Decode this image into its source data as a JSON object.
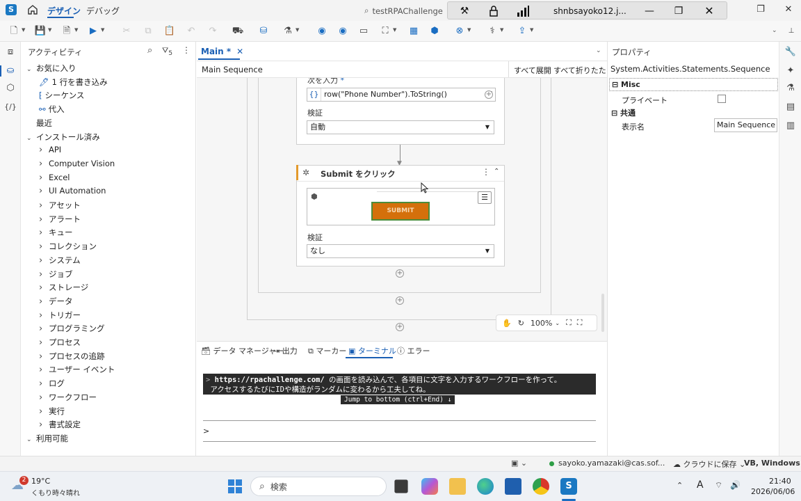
{
  "titlebar": {
    "app_logo": "S",
    "tab_design": "デザイン",
    "tab_debug": "デバッグ",
    "project_search": "testRPAChallenge",
    "rdp_user": "shnbsayoko12.j..."
  },
  "activities": {
    "title": "アクティビティ",
    "filter_count": "5",
    "items": [
      {
        "label": "お気に入り",
        "level": 0,
        "chev": "v"
      },
      {
        "label": "1 行を書き込み",
        "level": 1,
        "icon": "write-line"
      },
      {
        "label": "シーケンス",
        "level": 1,
        "icon": "sequence"
      },
      {
        "label": "代入",
        "level": 1,
        "icon": "assign"
      },
      {
        "label": "最近",
        "level": 0,
        "chev": ""
      },
      {
        "label": "インストール済み",
        "level": 0,
        "chev": "v"
      },
      {
        "label": "API",
        "level": 1,
        "chev": ">"
      },
      {
        "label": "Computer Vision",
        "level": 1,
        "chev": ">"
      },
      {
        "label": "Excel",
        "level": 1,
        "chev": ">"
      },
      {
        "label": "UI Automation",
        "level": 1,
        "chev": ">"
      },
      {
        "label": "アセット",
        "level": 1,
        "chev": ">"
      },
      {
        "label": "アラート",
        "level": 1,
        "chev": ">"
      },
      {
        "label": "キュー",
        "level": 1,
        "chev": ">"
      },
      {
        "label": "コレクション",
        "level": 1,
        "chev": ">"
      },
      {
        "label": "システム",
        "level": 1,
        "chev": ">"
      },
      {
        "label": "ジョブ",
        "level": 1,
        "chev": ">"
      },
      {
        "label": "ストレージ",
        "level": 1,
        "chev": ">"
      },
      {
        "label": "データ",
        "level": 1,
        "chev": ">"
      },
      {
        "label": "トリガー",
        "level": 1,
        "chev": ">"
      },
      {
        "label": "プログラミング",
        "level": 1,
        "chev": ">"
      },
      {
        "label": "プロセス",
        "level": 1,
        "chev": ">"
      },
      {
        "label": "プロセスの追跡",
        "level": 1,
        "chev": ">"
      },
      {
        "label": "ユーザー イベント",
        "level": 1,
        "chev": ">"
      },
      {
        "label": "ログ",
        "level": 1,
        "chev": ">"
      },
      {
        "label": "ワークフロー",
        "level": 1,
        "chev": ">"
      },
      {
        "label": "実行",
        "level": 1,
        "chev": ">"
      },
      {
        "label": "書式設定",
        "level": 1,
        "chev": ">"
      },
      {
        "label": "利用可能",
        "level": 0,
        "chev": "v"
      }
    ]
  },
  "designer": {
    "tab_label": "Main *",
    "breadcrumb": "Main Sequence",
    "expand_all": "すべて展開",
    "collapse_all": "すべて折りたたむ",
    "type_into": {
      "text_label": "次を入力",
      "required_mark": "*",
      "text_value": "row(\"Phone Number\").ToString()",
      "verify_label": "検証",
      "verify_value": "自動"
    },
    "click_activity": {
      "title": "Submit をクリック",
      "button_text": "SUBMIT",
      "verify_label": "検証",
      "verify_value": "なし"
    },
    "zoom": "100%"
  },
  "bottom_panel": {
    "tabs": [
      "データ マネージャー",
      "出力",
      "マーカー",
      "ターミナル",
      "エラー"
    ],
    "active_tab": "ターミナル",
    "terminal_line1_url": "https://rpachallenge.com/",
    "terminal_line1_rest": " の画面を読み込んで、各項目に文字を入力するワークフローを作って。",
    "terminal_line2": "アクセスするたびにIDや構造がランダムに変わるから工夫してね。",
    "jump_label": "Jump to bottom (ctrl+End) ↓",
    "prompt": ">"
  },
  "properties": {
    "title": "プロパティ",
    "type_name": "System.Activities.Statements.Sequence",
    "section_misc": "Misc",
    "private_label": "プライベート",
    "section_common": "共通",
    "display_name_label": "表示名",
    "display_name_value": "Main Sequence"
  },
  "statusbar": {
    "user_email": "sayoko.yamazaki@cas.sof...",
    "save_location": "クラウドに保存",
    "project_type": "VB, Windows"
  },
  "taskbar": {
    "weather_temp": "19°C",
    "weather_desc": "くもり時々晴れ",
    "weather_badge": "2",
    "search_placeholder": "検索",
    "time": "21:40",
    "date": "2026/06/06",
    "ime": "A"
  },
  "colors": {
    "accent": "#1a5fb4",
    "submit_button": "#d4700b",
    "submit_border": "#4c8c3a"
  }
}
